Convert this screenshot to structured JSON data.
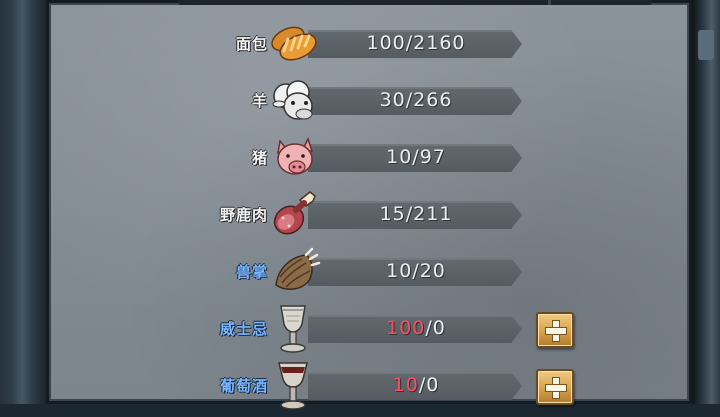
{
  "resources": [
    {
      "name": "面包",
      "current": "100",
      "max": "2160",
      "icon": "bread-icon",
      "label_color": "white",
      "current_color": "white",
      "has_plus": false
    },
    {
      "name": "羊",
      "current": "30",
      "max": "266",
      "icon": "sheep-icon",
      "label_color": "white",
      "current_color": "white",
      "has_plus": false
    },
    {
      "name": "猪",
      "current": "10",
      "max": "97",
      "icon": "pig-icon",
      "label_color": "white",
      "current_color": "white",
      "has_plus": false
    },
    {
      "name": "野鹿肉",
      "current": "15",
      "max": "211",
      "icon": "venison-icon",
      "label_color": "white",
      "current_color": "white",
      "has_plus": false
    },
    {
      "name": "兽掌",
      "current": "10",
      "max": "20",
      "icon": "paw-icon",
      "label_color": "blue",
      "current_color": "white",
      "has_plus": false
    },
    {
      "name": "威士忌",
      "current": "100",
      "max": "0",
      "icon": "whisky-goblet-icon",
      "label_color": "blue",
      "current_color": "red",
      "has_plus": true
    },
    {
      "name": "葡萄酒",
      "current": "10",
      "max": "0",
      "icon": "wine-goblet-icon",
      "label_color": "blue",
      "current_color": "red",
      "has_plus": true
    }
  ],
  "separator": "/",
  "colors": {
    "panel": "#7f878f",
    "value_bar": "#5a6167",
    "label_blue": "#7ab6ff",
    "insufficient_red": "#ff4d5b",
    "plus_button": "#d9a551"
  }
}
